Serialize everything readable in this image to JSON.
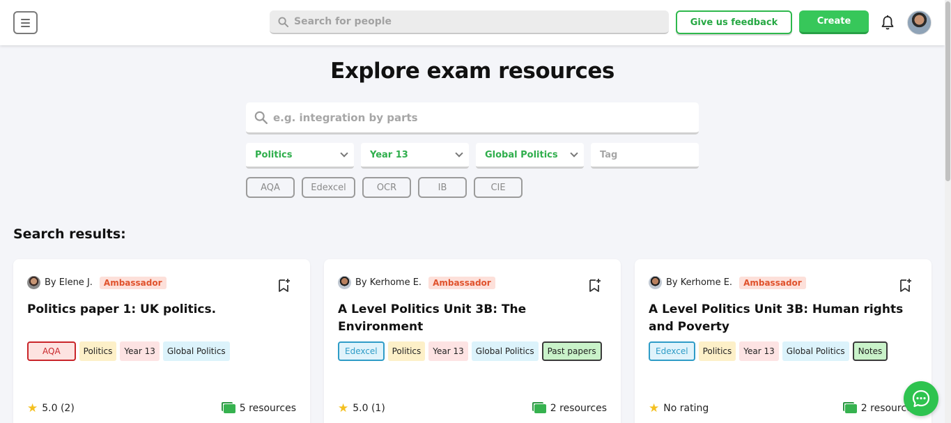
{
  "header": {
    "people_search_placeholder": "Search for people",
    "feedback_label": "Give us feedback",
    "create_label": "Create"
  },
  "hero": {
    "title": "Explore exam resources",
    "search_placeholder": "e.g. integration by parts",
    "filters": {
      "subject": "Politics",
      "year": "Year 13",
      "topic": "Global Politics",
      "tag_placeholder": "Tag"
    },
    "boards": [
      "AQA",
      "Edexcel",
      "OCR",
      "IB",
      "CIE"
    ]
  },
  "results": {
    "title": "Search results:",
    "cards": [
      {
        "author": "By Elene J.",
        "badge": "Ambassador",
        "title": "Politics paper 1: UK politics.",
        "tags": [
          "AQA",
          "Politics",
          "Year 13",
          "Global Politics"
        ],
        "rating": "5.0 (2)",
        "resources": "5 resources"
      },
      {
        "author": "By Kerhome E.",
        "badge": "Ambassador",
        "title": "A Level Politics Unit 3B: The Environment",
        "tags": [
          "Edexcel",
          "Politics",
          "Year 13",
          "Global Politics",
          "Past papers"
        ],
        "rating": "5.0 (1)",
        "resources": "2 resources"
      },
      {
        "author": "By Kerhome E.",
        "badge": "Ambassador",
        "title": "A Level Politics Unit 3B: Human rights and Poverty",
        "tags": [
          "Edexcel",
          "Politics",
          "Year 13",
          "Global Politics",
          "Notes"
        ],
        "rating": "No rating",
        "resources": "2 resources"
      }
    ]
  },
  "colors": {
    "brand_green": "#37c75a",
    "ambassador_red": "#e0522c",
    "aqa_red": "#c9252a",
    "edexcel_blue": "#2e9cc7"
  },
  "icons": [
    "menu-icon",
    "search-icon",
    "bell-icon",
    "avatar",
    "bookmark-add-icon",
    "star-icon",
    "folder-icon",
    "chat-icon"
  ]
}
